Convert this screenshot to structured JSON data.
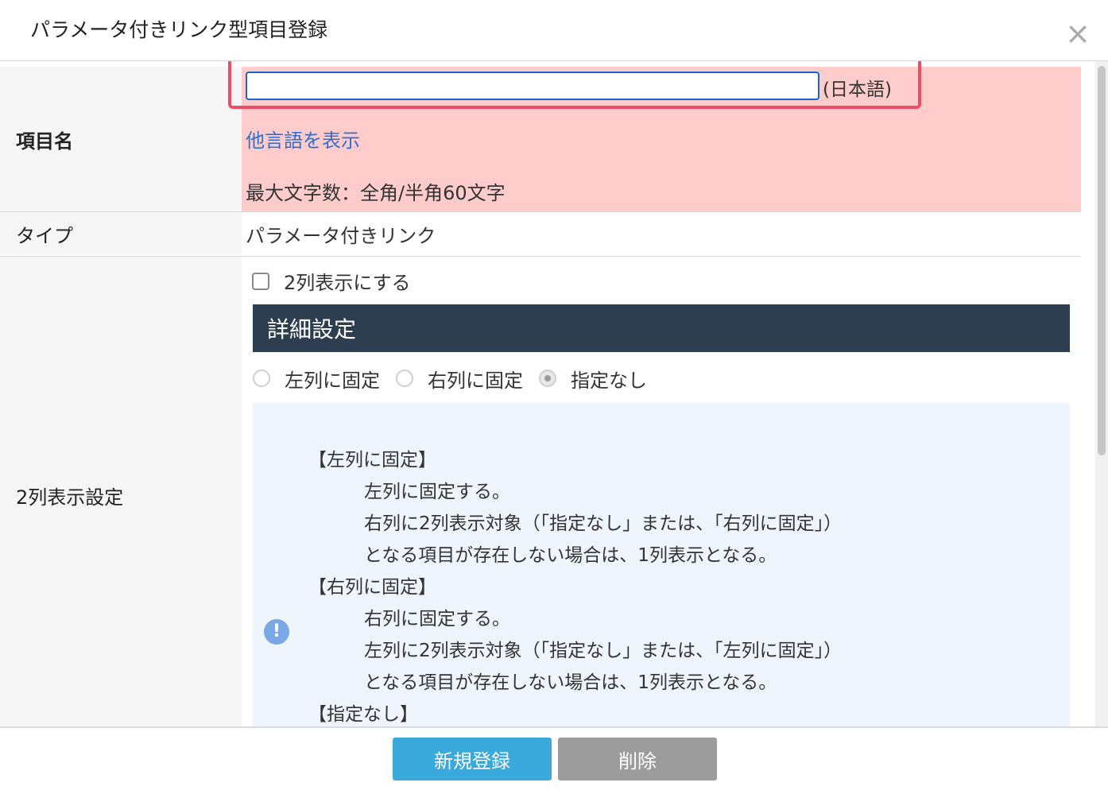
{
  "dialog": {
    "title": "パラメータ付きリンク型項目登録",
    "close_icon": "×"
  },
  "fields": {
    "name": {
      "label": "項目名",
      "value": "",
      "lang_label": "(日本語)",
      "other_lang_link": "他言語を表示",
      "max_chars_note": "最大文字数：全角/半角60文字"
    },
    "type": {
      "label": "タイプ",
      "value": "パラメータ付きリンク"
    },
    "two_column": {
      "label": "2列表示設定",
      "checkbox_label": "2列表示にする",
      "checkbox_checked": false,
      "section_title": "詳細設定",
      "radios": [
        {
          "label": "左列に固定",
          "checked": false
        },
        {
          "label": "右列に固定",
          "checked": false
        },
        {
          "label": "指定なし",
          "checked": true
        }
      ],
      "info_icon": "!",
      "info_lines": [
        "【左列に固定】",
        "左列に固定する。",
        "右列に2列表示対象（「指定なし」または、「右列に固定」）",
        "となる項目が存在しない場合は、1列表示となる。",
        "【右列に固定】",
        "右列に固定する。",
        "左列に2列表示対象（「指定なし」または、「左列に固定」）",
        "となる項目が存在しない場合は、1列表示となる。",
        "【指定なし】"
      ]
    }
  },
  "footer": {
    "register_button": "新規登録",
    "delete_button": "削除"
  },
  "colors": {
    "required_bg": "#ffcccc",
    "focus_border": "#ee4d63",
    "link": "#2f6fd1",
    "section_header": "#2d3e51",
    "info_bg": "#eef5fc",
    "primary_button": "#3aa9dc",
    "secondary_button": "#9c9c9c"
  }
}
